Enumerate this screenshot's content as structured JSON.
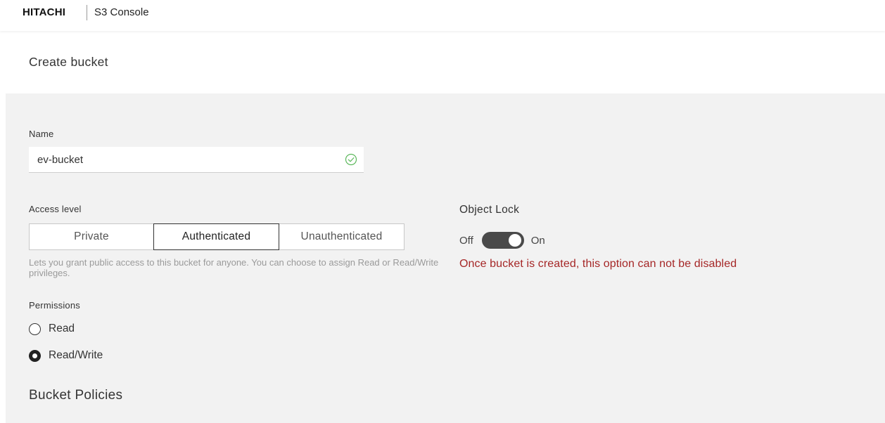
{
  "header": {
    "brand": "HITACHI",
    "app_name": "S3 Console"
  },
  "page": {
    "title": "Create bucket"
  },
  "form": {
    "name": {
      "label": "Name",
      "value": "ev-bucket",
      "valid_icon": "check-circle-icon",
      "valid_color": "#4caf50"
    },
    "access_level": {
      "label": "Access level",
      "options": [
        "Private",
        "Authenticated",
        "Unauthenticated"
      ],
      "selected": "Authenticated",
      "helper_text": "Lets you grant public access to this bucket for anyone. You can choose to assign Read or Read/Write privileges."
    },
    "permissions": {
      "label": "Permissions",
      "options": [
        "Read",
        "Read/Write"
      ],
      "selected": "Read/Write"
    },
    "object_lock": {
      "label": "Object Lock",
      "off_label": "Off",
      "on_label": "On",
      "enabled": true,
      "warning": "Once bucket is created, this option can not be disabled",
      "warning_color": "#a52626"
    },
    "bucket_policies": {
      "title": "Bucket Policies"
    }
  }
}
